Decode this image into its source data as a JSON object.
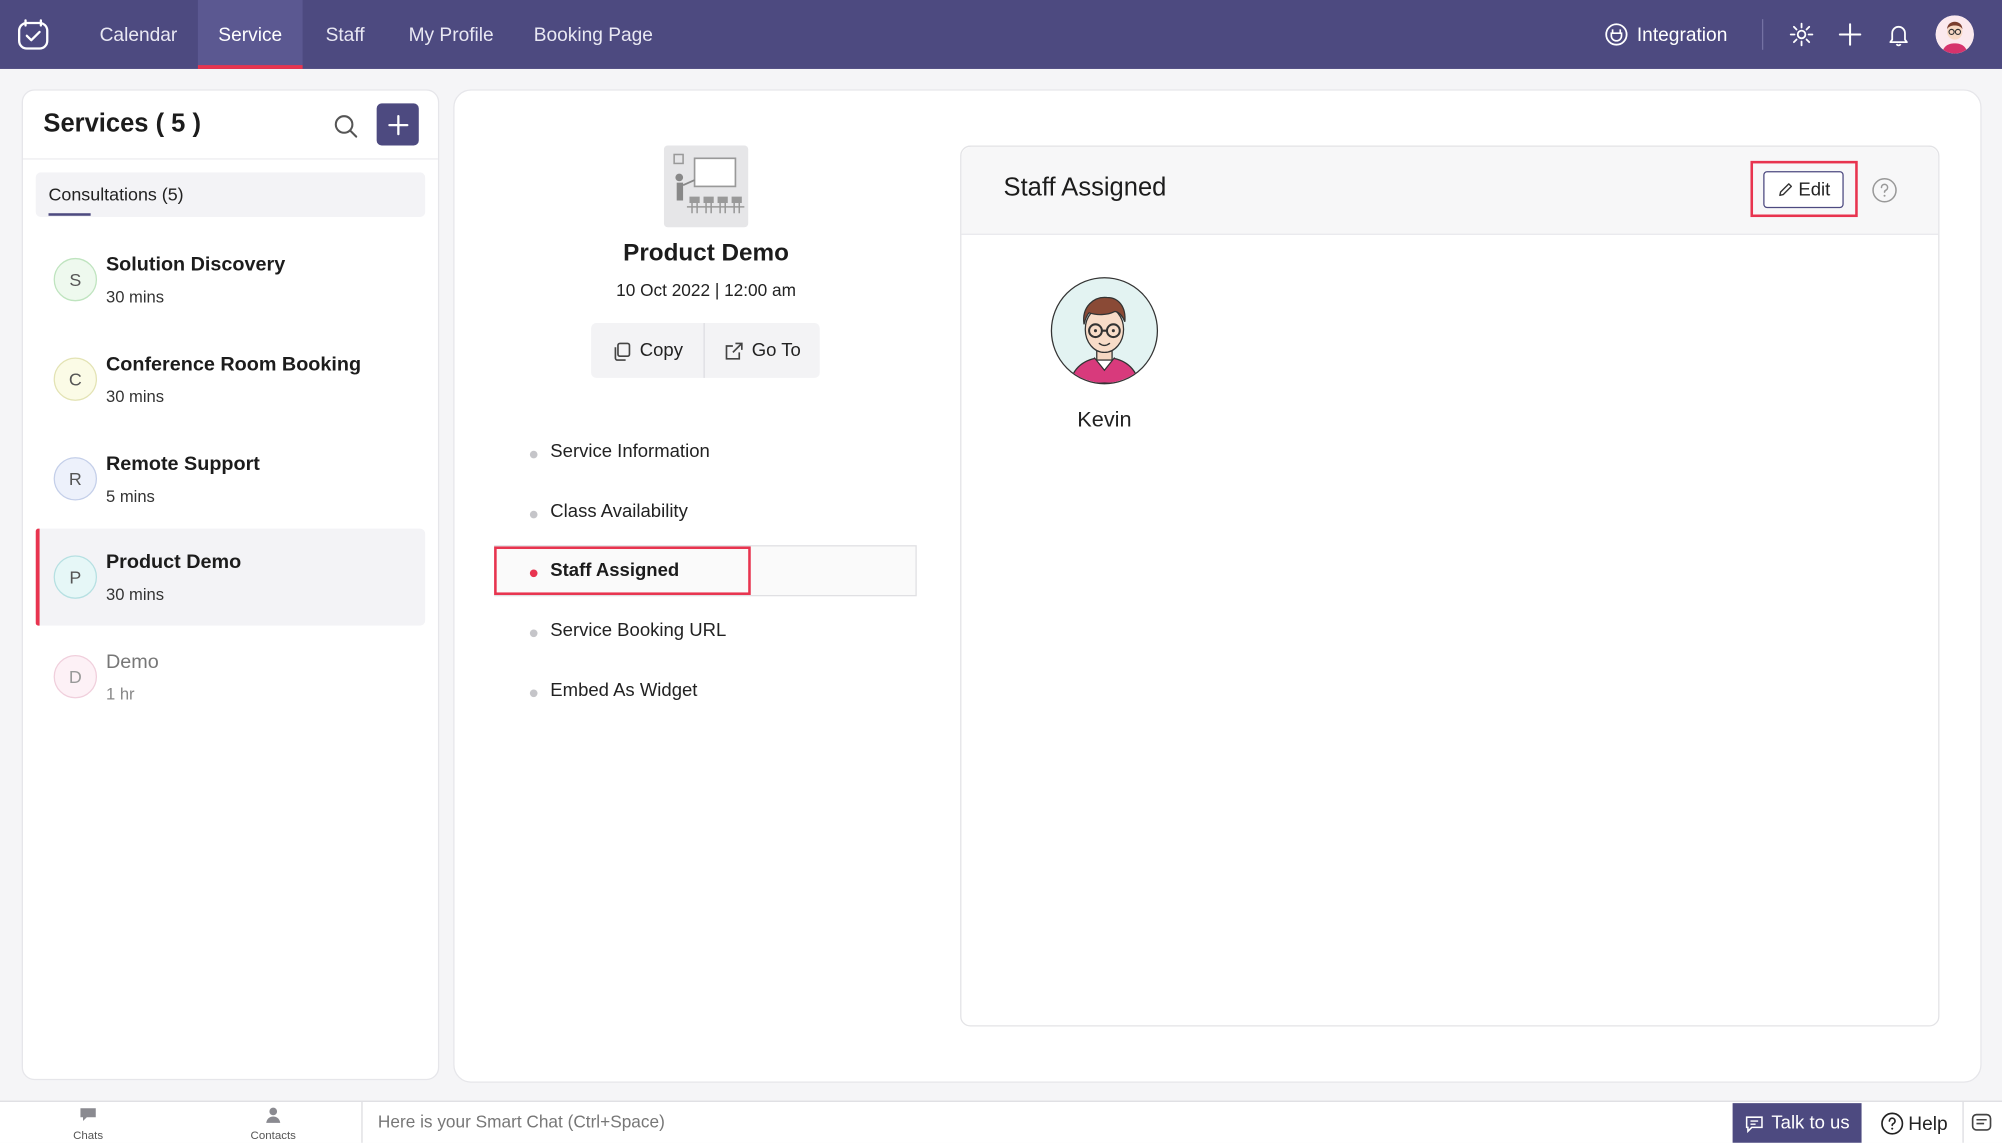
{
  "nav": {
    "tabs": [
      {
        "label": "Calendar"
      },
      {
        "label": "Service"
      },
      {
        "label": "Staff"
      },
      {
        "label": "My Profile"
      },
      {
        "label": "Booking Page"
      }
    ],
    "active_tab": "Service",
    "integration_label": "Integration",
    "accent_color": "#e8344f",
    "bar_color": "#4d4a80"
  },
  "services_panel": {
    "title": "Services ( 5 )",
    "category_label": "Consultations (5)",
    "items": [
      {
        "initial": "S",
        "name": "Solution Discovery",
        "duration": "30 mins"
      },
      {
        "initial": "C",
        "name": "Conference Room Booking",
        "duration": "30 mins"
      },
      {
        "initial": "R",
        "name": "Remote Support",
        "duration": "5 mins"
      },
      {
        "initial": "P",
        "name": "Product Demo",
        "duration": "30 mins"
      },
      {
        "initial": "D",
        "name": "Demo",
        "duration": "1 hr"
      }
    ],
    "selected": "Product Demo"
  },
  "service_detail": {
    "name": "Product Demo",
    "datetime": "10 Oct 2022 | 12:00 am",
    "copy_label": "Copy",
    "goto_label": "Go To",
    "sections": [
      {
        "label": "Service Information"
      },
      {
        "label": "Class Availability"
      },
      {
        "label": "Staff Assigned"
      },
      {
        "label": "Service Booking URL"
      },
      {
        "label": "Embed As Widget"
      }
    ],
    "active_section": "Staff Assigned"
  },
  "staff_assigned": {
    "title": "Staff Assigned",
    "edit_label": "Edit",
    "staff": [
      {
        "name": "Kevin"
      }
    ]
  },
  "bottom_bar": {
    "chats_label": "Chats",
    "contacts_label": "Contacts",
    "smart_chat_placeholder": "Here is your Smart Chat (Ctrl+Space)",
    "talk_label": "Talk to us",
    "help_label": "Help"
  }
}
